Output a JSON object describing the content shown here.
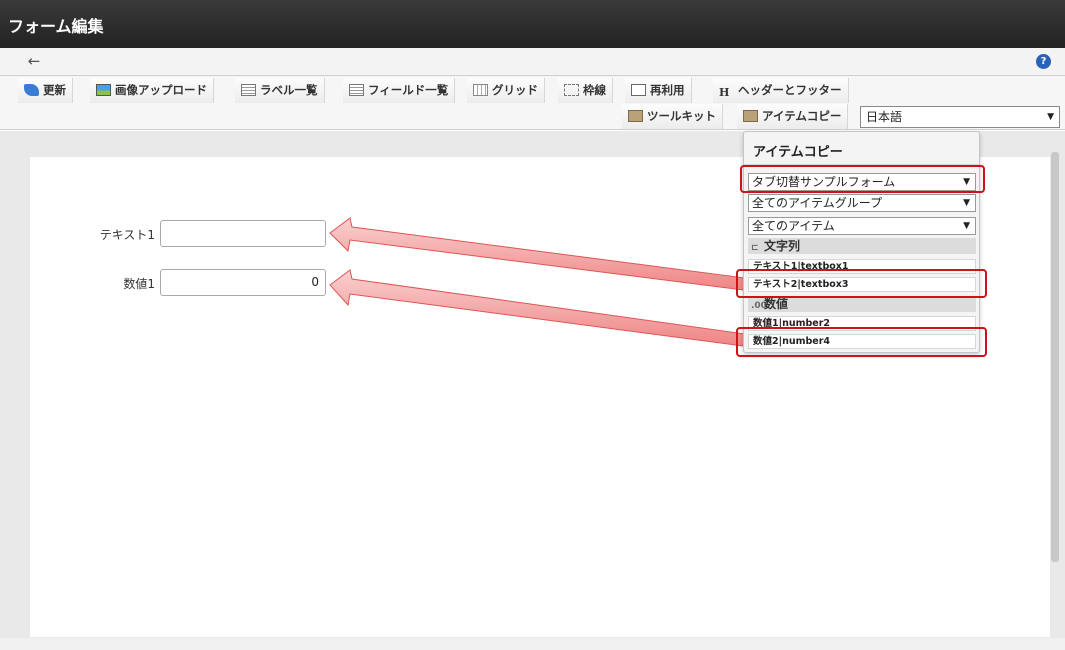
{
  "window": {
    "title": "フォーム編集"
  },
  "nav": {
    "back_icon": "←",
    "help_icon": "?"
  },
  "toolbar": {
    "row1": [
      {
        "label": "更新",
        "icon": "refresh-icon"
      },
      {
        "label": "画像アップロード",
        "icon": "image-upload-icon"
      },
      {
        "label": "ラベル一覧",
        "icon": "list-icon"
      },
      {
        "label": "フィールド一覧",
        "icon": "list-icon"
      },
      {
        "label": "グリッド",
        "icon": "grid-icon"
      },
      {
        "label": "枠線",
        "icon": "frame-icon"
      },
      {
        "label": "再利用",
        "icon": "document-icon"
      },
      {
        "label": "ヘッダーとフッター",
        "icon": "header-icon"
      }
    ],
    "row2": [
      {
        "label": "ツールキット",
        "icon": "toolkit-icon"
      },
      {
        "label": "アイテムコピー",
        "icon": "toolkit-icon"
      }
    ],
    "header_glyph": "H",
    "language": "日本語"
  },
  "form": {
    "fields": [
      {
        "label": "テキスト1",
        "value": ""
      },
      {
        "label": "数値1",
        "value": "0"
      }
    ]
  },
  "item_copy_panel": {
    "title": "アイテムコピー",
    "form_select": "タブ切替サンプルフォーム",
    "group_select": "全てのアイテムグループ",
    "item_select": "全てのアイテム",
    "groups": [
      {
        "name": "文字列",
        "icon": "text-icon",
        "items": [
          "テキスト1|textbox1",
          "テキスト2|textbox3"
        ]
      },
      {
        "name": "数値",
        "icon": ".00",
        "items": [
          "数値1|number2",
          "数値2|number4"
        ]
      }
    ]
  },
  "colors": {
    "highlight": "#d0101a",
    "arrow_fill": "#f4a3a3"
  }
}
